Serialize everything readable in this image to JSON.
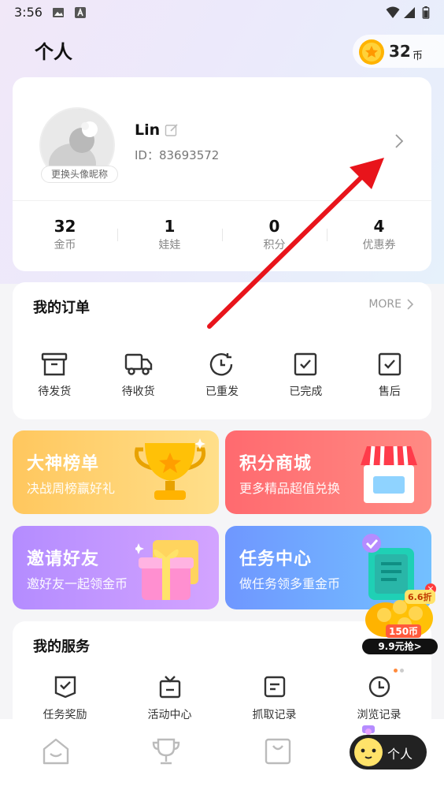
{
  "status_bar": {
    "time": "3:56"
  },
  "header": {
    "title": "个人",
    "coins": "32",
    "coin_unit": "币"
  },
  "profile": {
    "username": "Lin",
    "user_id": "ID：83693572",
    "avatar_badge": "更换头像昵称",
    "stats": [
      {
        "value": "32",
        "label": "金币"
      },
      {
        "value": "1",
        "label": "娃娃"
      },
      {
        "value": "0",
        "label": "积分"
      },
      {
        "value": "4",
        "label": "优惠券"
      }
    ]
  },
  "orders": {
    "title": "我的订单",
    "more": "MORE",
    "items": [
      {
        "label": "待发货",
        "icon": "box-icon"
      },
      {
        "label": "待收货",
        "icon": "truck-icon"
      },
      {
        "label": "已重发",
        "icon": "resend-clock-icon"
      },
      {
        "label": "已完成",
        "icon": "check-square-icon"
      },
      {
        "label": "售后",
        "icon": "after-sale-icon"
      }
    ]
  },
  "tiles": [
    {
      "title": "大神榜单",
      "subtitle": "决战周榜赢好礼",
      "icon": "trophy-icon"
    },
    {
      "title": "积分商城",
      "subtitle": "更多精品超值兑换",
      "icon": "shop-icon"
    },
    {
      "title": "邀请好友",
      "subtitle": "邀好友一起领金币",
      "icon": "gift-icon"
    },
    {
      "title": "任务中心",
      "subtitle": "做任务领多重金币",
      "icon": "task-list-icon"
    }
  ],
  "services": {
    "title": "我的服务",
    "items": [
      {
        "label": "任务奖励",
        "icon": "task-reward-icon"
      },
      {
        "label": "活动中心",
        "icon": "activity-icon"
      },
      {
        "label": "抓取记录",
        "icon": "grab-record-icon"
      },
      {
        "label": "浏览记录",
        "icon": "history-icon"
      }
    ]
  },
  "promo": {
    "discount": "6.6折",
    "coins": "150币",
    "button": "9.9元抢>"
  },
  "bottom_nav": {
    "profile_label": "个人"
  },
  "colors": {
    "annotation_arrow": "#e8141b",
    "rank_tile": "#ffc75e",
    "mall_tile": "#ff6a6f",
    "invite_tile": "#b48cff",
    "task_tile": "#6f97ff"
  }
}
